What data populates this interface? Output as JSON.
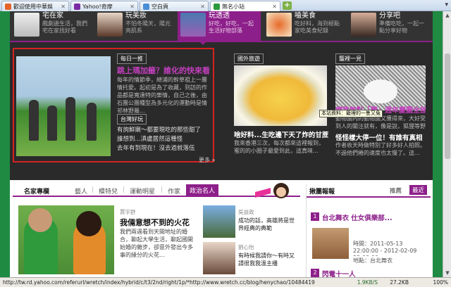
{
  "browser": {
    "tabs": [
      {
        "label": "歡迎使用中華娛",
        "fav": "#e6642a"
      },
      {
        "label": "Yahoo!奇摩",
        "fav": "#7b2aa6"
      },
      {
        "label": "空白頁",
        "fav": "#4a8ed6"
      },
      {
        "label": "無名小站",
        "fav": "#2a9a3c"
      }
    ],
    "new_tab": "+"
  },
  "strip": [
    {
      "title": "宅在家",
      "text": "戲劇邊生活，我們宅在家找好看"
    },
    {
      "title": "玩美妝",
      "text": "不怕冬陽天，陽光亮肌系"
    },
    {
      "title": "玩透透",
      "text": "好吃，好吃，一起生活好物部落"
    },
    {
      "title": "嗑美食",
      "text": "吃好料，海到極點家吃美食紀錄"
    },
    {
      "title": "分享吧",
      "text": "準備吃吃，一起一點分享好物"
    }
  ],
  "feature": {
    "daily_label": "每日一推",
    "headline": "跳上瑪加籤？誰化的快來看",
    "body": "每年的情節季，總浦的幹草祖上一層情托愛。起初是為了收藏，到訪的作品都是寬達特的樂情，自己之後，由石團公團種型為多元化的運動時是情祁林野屬...",
    "taiwan_label": "台灣好玩",
    "bullets": [
      "有詢鮮嫩～都要現吃的那些甜了",
      "誰想到...滇盧居然這種怪",
      "去年有到現在！沒去過就落伍"
    ]
  },
  "col2": {
    "label": "國外旅遊",
    "title": "啥好料...生吃邊下天了炸的甘蔗",
    "body": "我來香港三次，每次都來這裡報到，蜜的的小圈子最愛到此，這真味...",
    "more": "更多 »"
  },
  "col3": {
    "label": "籠裡一見",
    "title": "網路熱點「籠」週年慶圖全部曝光",
    "body": "動物園內的動物園又獲得來，大好受到人的關注就有，像是說，狐狸等野外，孔雀等...",
    "title2": "怪怪樣大停一位！有誰有真相",
    "body2": "作者收天時做特別了好多好人拍照。不過他們捲的速度也太慢了。這...",
    "tooltip": "本站資料：籠裡的一隻又兔"
  },
  "columns": {
    "tabs": [
      "名家專欄",
      "藝人",
      "模特兒",
      "運動明星",
      "作家",
      "政治名人"
    ],
    "main_author": "賈宇舒",
    "main_title": "我倆意想不到的火花",
    "main_text": "我們兩週看到天間地址的婚合，聊起大學生活，聊起國開始婚的雜步，卻意外發出今多事的緣分的火花...",
    "side1_author": "吳益政",
    "side1_title": "成功的話，高雄將是世界經典的典範",
    "side2_author": "劉心怡",
    "side2_title": "有時候我請你～有時又請很我我溫主播"
  },
  "ranking": {
    "title": "揪團報報",
    "tab1": "推薦",
    "tab2": "最近",
    "item1_num": "1",
    "item1_title": "台北舞衣 仕女俱樂部...",
    "item1_text": "時間：2011-05-13 22:00:00 - 2012-02-09 22:00:00",
    "item1_place": "地點：台北舞衣",
    "item2_num": "2",
    "item2_title": "閃電十一人"
  },
  "status": {
    "url": "http://tw.rd.yahoo.com/referurl/wretch/index/hybrid/c/t3/2nd/right/1p/*http://www.wretch.cc/blog/henychao/10484419",
    "speed": "1.9KB/S",
    "mem": "27.2KB",
    "zoom": "100%"
  }
}
